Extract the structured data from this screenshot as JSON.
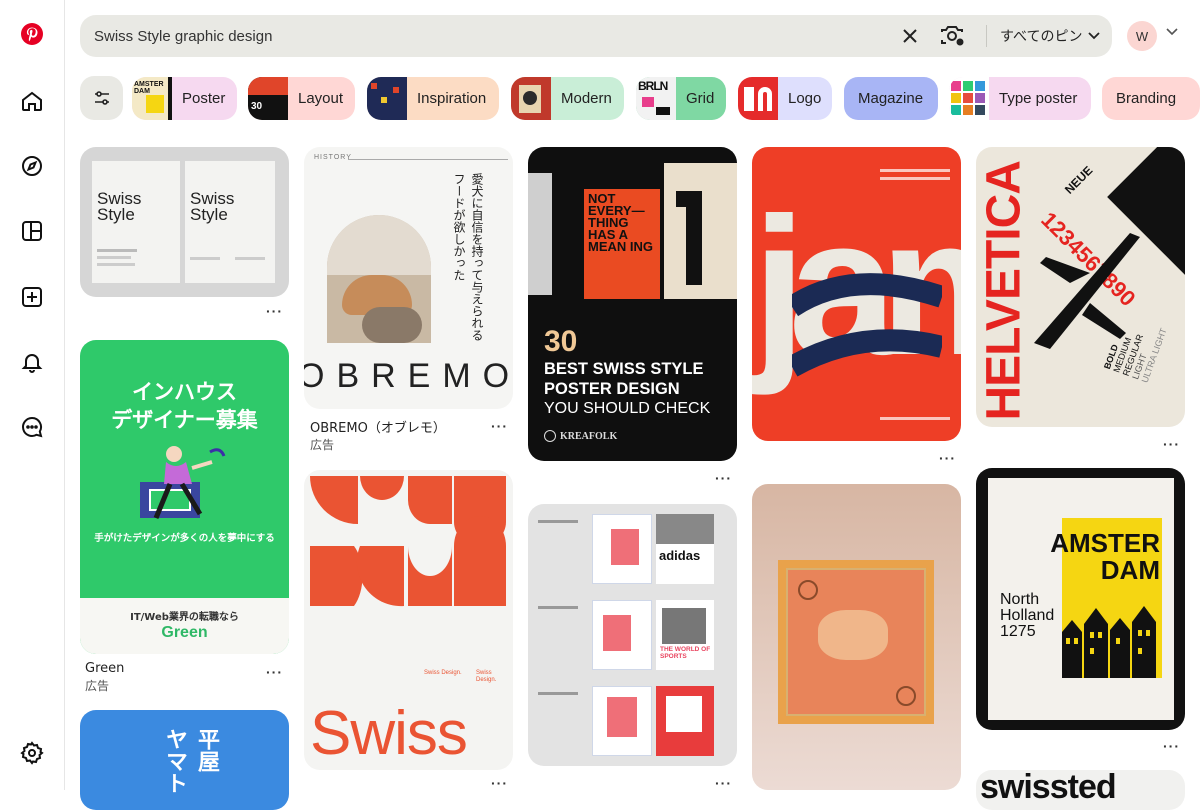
{
  "search": {
    "query": "Swiss Style graphic design",
    "scope": "すべてのピン"
  },
  "account": {
    "initial": "W"
  },
  "chips": [
    {
      "label": "Poster",
      "color": "#f6d9f0"
    },
    {
      "label": "Layout",
      "color": "#ffd7d5"
    },
    {
      "label": "Inspiration",
      "color": "#fcdcc4"
    },
    {
      "label": "Modern",
      "color": "#c9eed7"
    },
    {
      "label": "Grid",
      "color": "#7fd8a3"
    },
    {
      "label": "Logo",
      "color": "#dedffd"
    },
    {
      "label": "Magazine",
      "color": "#a8b5f5"
    },
    {
      "label": "Type poster",
      "color": "#f6d9f0"
    },
    {
      "label": "Branding",
      "color": "#ffd7d5"
    }
  ],
  "pins": {
    "swiss_book": {
      "line1": "Swiss",
      "line2": "Style"
    },
    "green_ad": {
      "headline1": "インハウス",
      "headline2": "デザイナー募集",
      "tagline": "手がけたデザインが多くの人を夢中にする",
      "sub": "IT/Web業界の転職なら",
      "brand": "Green",
      "title": "Green",
      "ad_label": "広告"
    },
    "obremo": {
      "category": "HISTORY",
      "wordmark": "OBREMO",
      "vertical_text": "愛犬に自信を持って与えられるフードが欲しかった",
      "title": "OBREMO（オブレモ）",
      "ad_label": "広告"
    },
    "kreafolk": {
      "number": "30",
      "line1": "BEST SWISS STYLE",
      "line2": "POSTER DESIGN",
      "line3": "YOU SHOULD CHECK",
      "brand": "KREAFOLK",
      "poster_text": "NOT EVERY— THING HAS A MEAN ING"
    },
    "jam": {
      "letters": "jam"
    },
    "helvetica": {
      "word": "HELVETICA",
      "neue": "NEUE",
      "digits": "1234567890",
      "weights": [
        "BOLD",
        "MEDIUM",
        "REGULAR",
        "LIGHT",
        "ULTRA LIGHT"
      ]
    },
    "swiss_shapes": {
      "word": "Swiss",
      "small1": "Swiss Design.",
      "small2": "Swiss Design."
    },
    "adidas": {
      "brand": "adidas",
      "sport": "THE WORLD OF SPORTS"
    },
    "amsterdam": {
      "line1": "AMSTER",
      "line2": "DAM",
      "place1": "North",
      "place2": "Holland",
      "num": "1275"
    },
    "yamato": {
      "text1": "平屋",
      "text2": "ヤマト"
    },
    "swissted": {
      "text": "swissted"
    }
  }
}
